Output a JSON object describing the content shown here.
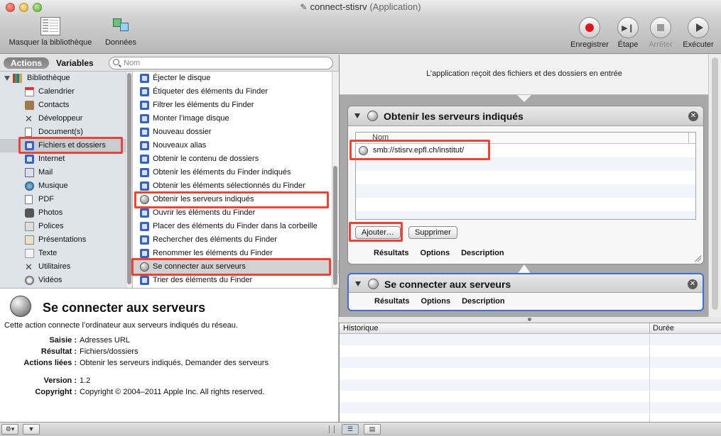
{
  "window": {
    "title": "connect-stisrv",
    "subtitle": "(Application)"
  },
  "toolbar": {
    "hide_library": "Masquer la bibliothèque",
    "data": "Données",
    "record": "Enregistrer",
    "step": "Étape",
    "stop": "Arrêter",
    "run": "Exécuter"
  },
  "library_header": {
    "actions_tab": "Actions",
    "variables_tab": "Variables",
    "search_placeholder": "Nom"
  },
  "library": {
    "root": "Bibliothèque",
    "items": [
      {
        "label": "Calendrier",
        "icon": "calendar-icon"
      },
      {
        "label": "Contacts",
        "icon": "contacts-icon"
      },
      {
        "label": "Développeur",
        "icon": "developer-icon"
      },
      {
        "label": "Document(s)",
        "icon": "document-icon"
      },
      {
        "label": "Fichiers et dossiers",
        "icon": "finder-icon"
      },
      {
        "label": "Internet",
        "icon": "internet-icon"
      },
      {
        "label": "Mail",
        "icon": "mail-icon"
      },
      {
        "label": "Musique",
        "icon": "music-icon"
      },
      {
        "label": "PDF",
        "icon": "pdf-icon"
      },
      {
        "label": "Photos",
        "icon": "photos-icon"
      },
      {
        "label": "Polices",
        "icon": "fonts-icon"
      },
      {
        "label": "Présentations",
        "icon": "presentations-icon"
      },
      {
        "label": "Texte",
        "icon": "text-icon"
      },
      {
        "label": "Utilitaires",
        "icon": "utilities-icon"
      },
      {
        "label": "Vidéos",
        "icon": "videos-icon"
      }
    ]
  },
  "actions": [
    "Éjecter le disque",
    "Étiqueter des éléments du Finder",
    "Filtrer les éléments du Finder",
    "Monter l’image disque",
    "Nouveau dossier",
    "Nouveaux alias",
    "Obtenir le contenu de dossiers",
    "Obtenir les éléments du Finder indiqués",
    "Obtenir les éléments sélectionnés du Finder",
    "Obtenir les serveurs indiqués",
    "Ouvrir les éléments du Finder",
    "Placer des éléments du Finder dans la corbeille",
    "Rechercher des éléments du Finder",
    "Renommer les éléments du Finder",
    "Se connecter aux serveurs",
    "Trier des éléments du Finder"
  ],
  "description": {
    "title": "Se connecter aux serveurs",
    "text": "Cette action connecte l’ordinateur aux serveurs indiqués du réseau.",
    "input_label": "Saisie :",
    "input_value": "Adresses URL",
    "result_label": "Résultat :",
    "result_value": "Fichiers/dossiers",
    "related_label": "Actions liées :",
    "related_value": "Obtenir les serveurs indiqués, Demander des serveurs",
    "version_label": "Version :",
    "version_value": "1.2",
    "copyright_label": "Copyright :",
    "copyright_value": "Copyright © 2004–2011 Apple Inc.  All rights reserved."
  },
  "workflow": {
    "header": "L’application reçoit des fichiers et des dossiers en entrée",
    "card1": {
      "title": "Obtenir les serveurs indiqués",
      "column": "Nom",
      "urls": [
        "smb://stisrv.epfl.ch/institut/"
      ],
      "add_button": "Ajouter…",
      "remove_button": "Supprimer",
      "tabs": [
        "Résultats",
        "Options",
        "Description"
      ]
    },
    "card2": {
      "title": "Se connecter aux serveurs",
      "tabs": [
        "Résultats",
        "Options",
        "Description"
      ]
    }
  },
  "log": {
    "history": "Historique",
    "duration": "Durée"
  },
  "colors": {
    "highlight": "#e8443a",
    "selection_blue": "#3b6fd4",
    "record_red": "#e3141c"
  }
}
